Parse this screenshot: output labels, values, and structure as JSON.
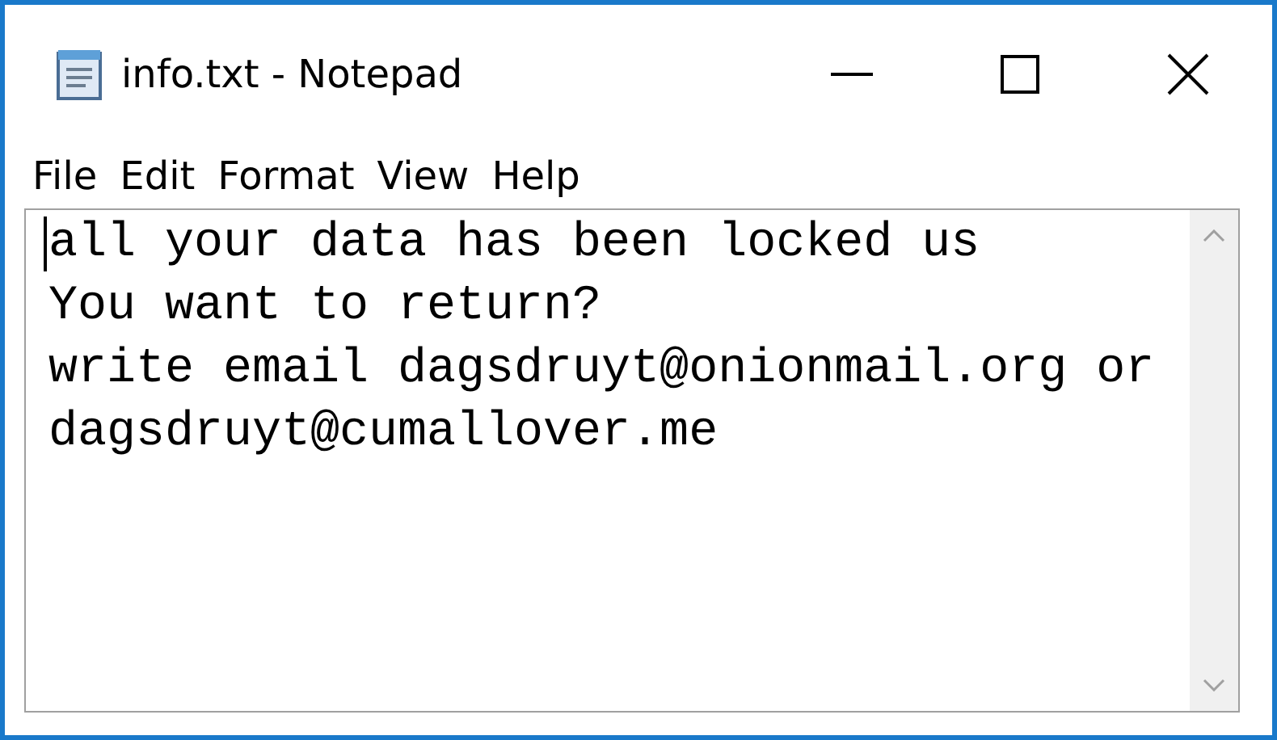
{
  "window": {
    "title": "info.txt - Notepad"
  },
  "menu": [
    "File",
    "Edit",
    "Format",
    "View",
    "Help"
  ],
  "document": {
    "lines": [
      "all your data has been locked us",
      "You want to return?",
      "write email dagsdruyt@onionmail.org or",
      "dagsdruyt@cumallover.me"
    ]
  }
}
